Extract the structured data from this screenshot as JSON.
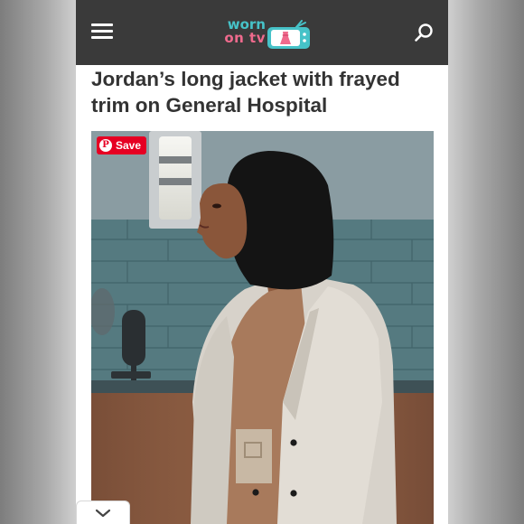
{
  "header": {
    "menu_icon": "hamburger-icon",
    "logo": {
      "word1": "worn",
      "word2": "on tv",
      "icon": "tv-dress-icon",
      "color_teal": "#46c2c8",
      "color_pink": "#ef6a8d"
    },
    "search_icon": "search-icon",
    "bar_color": "#3a3a3a"
  },
  "article": {
    "title": "Jordan’s long jacket with frayed trim on General Hospital"
  },
  "photo": {
    "save_label": "Save",
    "save_icon": "pinterest-icon",
    "save_color": "#e60023"
  },
  "footer": {
    "expand_icon": "chevron-down-icon"
  }
}
